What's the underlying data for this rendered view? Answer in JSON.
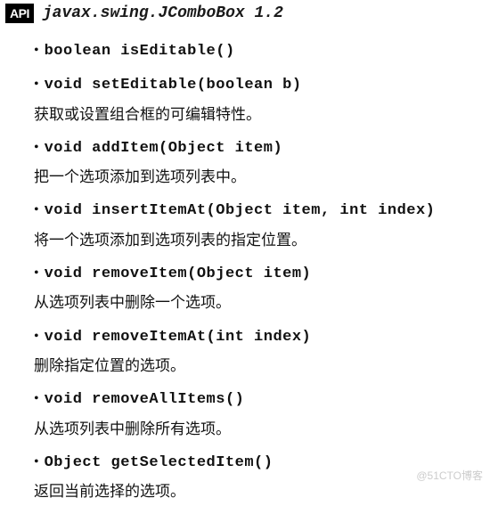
{
  "header": {
    "badge": "API",
    "title": "javax.swing.JComboBox 1.2"
  },
  "methods": [
    {
      "signature": "boolean isEditable()",
      "desc": ""
    },
    {
      "signature": "void setEditable(boolean b)",
      "desc": "获取或设置组合框的可编辑特性。"
    },
    {
      "signature": "void addItem(Object item)",
      "desc": "把一个选项添加到选项列表中。"
    },
    {
      "signature": "void insertItemAt(Object item, int index)",
      "desc": "将一个选项添加到选项列表的指定位置。"
    },
    {
      "signature": "void removeItem(Object item)",
      "desc": "从选项列表中删除一个选项。"
    },
    {
      "signature": "void removeItemAt(int index)",
      "desc": "删除指定位置的选项。"
    },
    {
      "signature": "void removeAllItems()",
      "desc": "从选项列表中删除所有选项。"
    },
    {
      "signature": "Object getSelectedItem()",
      "desc": "返回当前选择的选项。"
    }
  ],
  "watermark": "@51CTO博客"
}
